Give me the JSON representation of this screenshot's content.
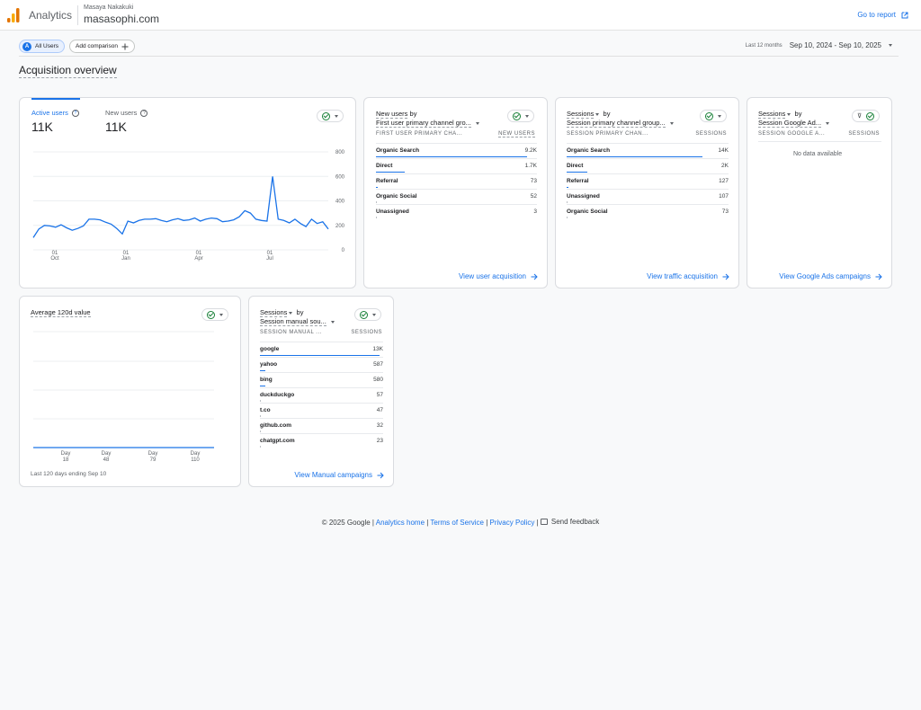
{
  "header": {
    "app_name": "Analytics",
    "account_name": "Masaya Nakakuki",
    "property_name": "masasophi.com",
    "go_to_report": "Go to report"
  },
  "colors": {
    "accent": "#1a73e8",
    "check": "#188038",
    "logo_dark": "#e37400",
    "logo_light": "#f9ab00"
  },
  "toolbar": {
    "comparison_chip_badge": "A",
    "comparison_chip": "All Users",
    "add_comparison": "Add comparison",
    "date_label": "Last 12 months",
    "date_range": "Sep 10, 2024 - Sep 10, 2025"
  },
  "page_title": "Acquisition overview",
  "overview_card": {
    "tabs": [
      {
        "label": "Active users",
        "value": "11K"
      },
      {
        "label": "New users",
        "value": "11K"
      }
    ],
    "chart_data": {
      "type": "line",
      "x_tick_labels": [
        [
          "01",
          "Oct"
        ],
        [
          "01",
          "Jan"
        ],
        [
          "01",
          "Apr"
        ],
        [
          "01",
          "Jul"
        ]
      ],
      "y_tick_labels": [
        "800",
        "600",
        "400",
        "200",
        "0"
      ],
      "ylim": [
        0,
        800
      ],
      "series": [
        {
          "values": [
            100,
            170,
            200,
            195,
            185,
            205,
            180,
            160,
            175,
            195,
            250,
            250,
            245,
            225,
            210,
            175,
            130,
            235,
            220,
            240,
            250,
            250,
            255,
            240,
            230,
            245,
            255,
            240,
            245,
            260,
            235,
            250,
            260,
            255,
            230,
            235,
            245,
            270,
            320,
            300,
            250,
            240,
            235,
            600,
            250,
            240,
            220,
            250,
            215,
            190,
            250,
            215,
            230,
            170
          ]
        }
      ]
    }
  },
  "new_users_card": {
    "title_metric": "New users",
    "title_by": "by",
    "title_dimension": "First user primary channel gro...",
    "col_dimension": "FIRST USER PRIMARY CHA...",
    "col_metric": "NEW USERS",
    "rows": [
      {
        "label": "Organic Search",
        "value": "9.2K",
        "frac": 0.94
      },
      {
        "label": "Direct",
        "value": "1.7K",
        "frac": 0.18
      },
      {
        "label": "Referral",
        "value": "73",
        "frac": 0.01
      },
      {
        "label": "Organic Social",
        "value": "52",
        "frac": 0.005
      },
      {
        "label": "Unassigned",
        "value": "3",
        "frac": 0.0
      }
    ],
    "link": "View user acquisition"
  },
  "sessions_channel_card": {
    "title_metric": "Sessions",
    "title_by": "by",
    "title_dimension": "Session primary channel group...",
    "col_dimension": "SESSION PRIMARY CHAN...",
    "col_metric": "SESSIONS",
    "rows": [
      {
        "label": "Organic Search",
        "value": "14K",
        "frac": 0.84
      },
      {
        "label": "Direct",
        "value": "2K",
        "frac": 0.13
      },
      {
        "label": "Referral",
        "value": "127",
        "frac": 0.01
      },
      {
        "label": "Unassigned",
        "value": "107",
        "frac": 0.008
      },
      {
        "label": "Organic Social",
        "value": "73",
        "frac": 0.005
      }
    ],
    "link": "View traffic acquisition"
  },
  "sessions_ads_card": {
    "title_metric": "Sessions",
    "title_by": "by",
    "title_dimension": "Session Google Ad...",
    "col_dimension": "SESSION GOOGLE A...",
    "col_metric": "SESSIONS",
    "no_data": "No data available",
    "link": "View Google Ads campaigns",
    "filter_icon_glyph": "⊽"
  },
  "avg_value_card": {
    "title": "Average 120d value",
    "chart_data": {
      "type": "line",
      "x_tick_labels": [
        [
          "Day",
          "18"
        ],
        [
          "Day",
          "48"
        ],
        [
          "Day",
          "79"
        ],
        [
          "Day",
          "110"
        ]
      ],
      "series": [
        {
          "values": [
            0,
            0,
            0,
            0,
            0
          ]
        }
      ]
    },
    "footnote": "Last 120 days ending Sep 10"
  },
  "manual_source_card": {
    "title_metric": "Sessions",
    "title_by": "by",
    "title_dimension": "Session manual sou...",
    "col_dimension": "SESSION MANUAL ...",
    "col_metric": "SESSIONS",
    "rows": [
      {
        "label": "google",
        "value": "13K",
        "frac": 0.97
      },
      {
        "label": "yahoo",
        "value": "587",
        "frac": 0.045
      },
      {
        "label": "bing",
        "value": "580",
        "frac": 0.045
      },
      {
        "label": "duckduckgo",
        "value": "57",
        "frac": 0.005
      },
      {
        "label": "t.co",
        "value": "47",
        "frac": 0.004
      },
      {
        "label": "github.com",
        "value": "32",
        "frac": 0.003
      },
      {
        "label": "chatgpt.com",
        "value": "23",
        "frac": 0.002
      }
    ],
    "link": "View Manual campaigns"
  },
  "footer": {
    "copyright": "© 2025 Google",
    "sep": "|",
    "analytics_home": "Analytics home",
    "terms": "Terms of Service",
    "privacy": "Privacy Policy",
    "feedback": "Send feedback"
  }
}
